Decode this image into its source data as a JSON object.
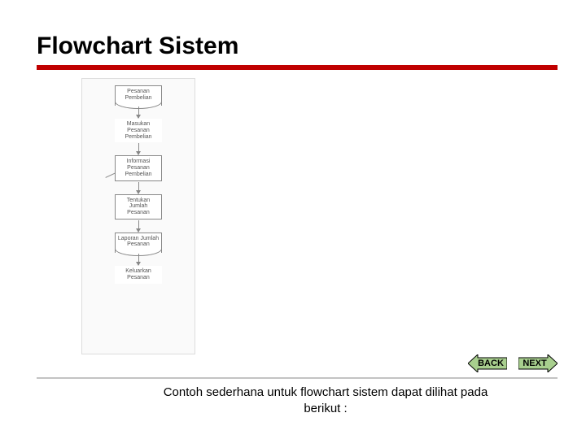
{
  "title": "Flowchart Sistem",
  "flowchart": {
    "nodes": [
      {
        "label": "Pesanan Pembelian",
        "shape": "document"
      },
      {
        "label": "Masukan Pesanan Pembelian",
        "shape": "trapezoid"
      },
      {
        "label": "Informasi Pesanan Pembelian",
        "shape": "process"
      },
      {
        "label": "Tentukan Jumlah Pesanan",
        "shape": "process"
      },
      {
        "label": "Laporan Jumlah Pesanan",
        "shape": "document"
      },
      {
        "label": "Keluarkan Pesanan",
        "shape": "trapezoid-down"
      }
    ]
  },
  "nav": {
    "back_label": "BACK",
    "next_label": "NEXT"
  },
  "caption": "Contoh sederhana untuk flowchart sistem dapat dilihat pada berikut :",
  "colors": {
    "accent": "#c00000",
    "nav_fill": "#a8cf8e",
    "nav_stroke": "#000000"
  }
}
